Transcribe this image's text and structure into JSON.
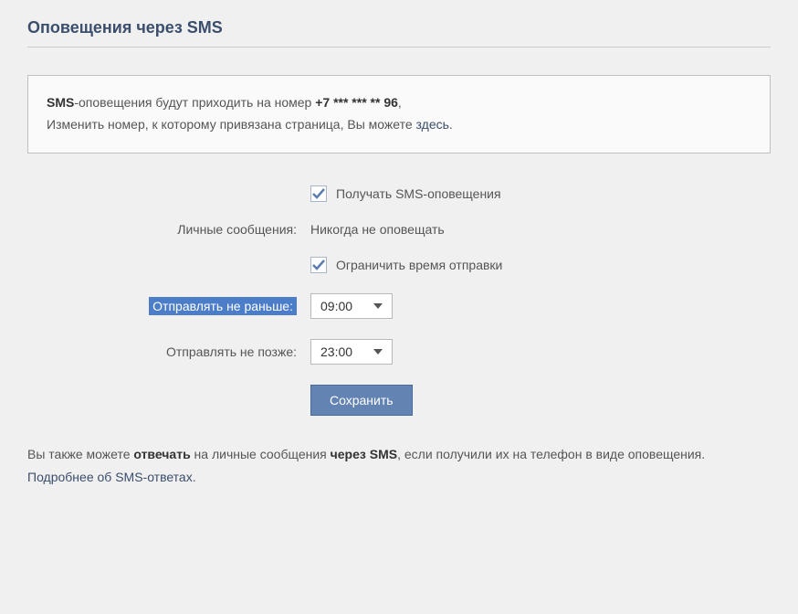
{
  "heading": "Оповещения через SMS",
  "notice": {
    "prefix_bold": "SMS",
    "line1_part1": "-оповещения будут приходить на номер ",
    "phone_bold": "+7 *** *** ** 96",
    "line1_end": ",",
    "line2_part1": "Изменить номер, к которому привязана страница, Вы можете ",
    "here_link": "здесь",
    "line2_end": "."
  },
  "form": {
    "receive_sms_label": "Получать SMS-оповещения",
    "personal_messages_label": "Личные сообщения:",
    "personal_messages_value": "Никогда не оповещать",
    "limit_time_label": "Ограничить время отправки",
    "send_not_earlier_label": "Отправлять не раньше:",
    "send_not_earlier_value": "09:00",
    "send_not_later_label": "Отправлять не позже:",
    "send_not_later_value": "23:00",
    "save_button": "Сохранить"
  },
  "footer": {
    "part1": "Вы также можете ",
    "bold1": "отвечать",
    "part2": " на личные сообщения ",
    "bold2": "через SMS",
    "part3": ", если получили их на телефон в виде оповещения. ",
    "link": "Подробнее об SMS-ответах",
    "end": "."
  }
}
